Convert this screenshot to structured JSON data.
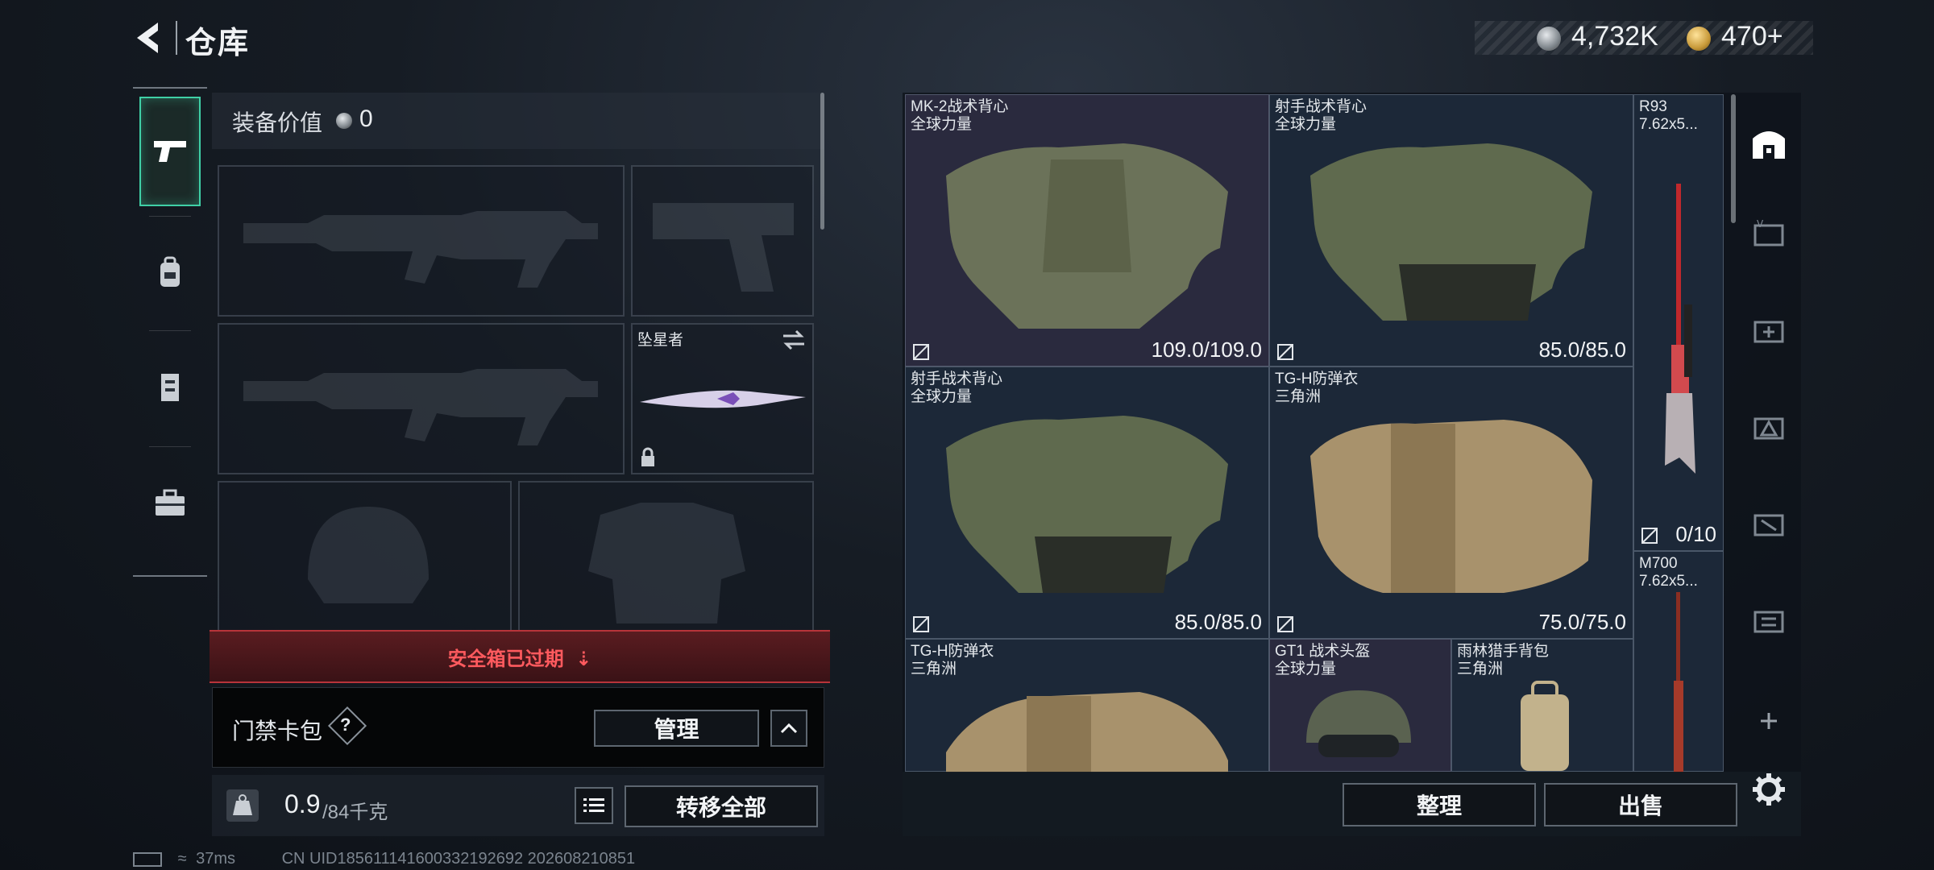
{
  "header": {
    "title": "仓库",
    "currency_silver": "4,732K",
    "currency_gold": "470+"
  },
  "left_nav": {
    "items": [
      "weapons",
      "backpack",
      "vest",
      "toolbox"
    ]
  },
  "equipment": {
    "value_label": "装备价值",
    "value": "0",
    "melee_name": "坠星者",
    "safebox_status": "安全箱已过期",
    "keycard_label": "门禁卡包",
    "keycard_help": "?",
    "manage_label": "管理",
    "weight_current": "0.9",
    "weight_capacity": "/84千克",
    "transfer_all_label": "转移全部"
  },
  "stash": {
    "items": [
      {
        "name": "MK-2战术背心",
        "sub": "全球力量",
        "durability": "109.0/109.0"
      },
      {
        "name": "射手战术背心",
        "sub": "全球力量",
        "durability": "85.0/85.0"
      },
      {
        "name": "射手战术背心",
        "sub": "全球力量",
        "durability": "85.0/85.0"
      },
      {
        "name": "TG-H防弹衣",
        "sub": "三角洲",
        "durability": "75.0/75.0"
      },
      {
        "name": "TG-H防弹衣",
        "sub": "三角洲",
        "durability": ""
      },
      {
        "name": "GT1 战术头盔",
        "sub": "全球力量",
        "durability": ""
      },
      {
        "name": "雨林猎手背包",
        "sub": "三角洲",
        "durability": ""
      }
    ],
    "side_items": [
      {
        "name": "R93",
        "sub": "7.62x5...",
        "count": "0/10"
      },
      {
        "name": "M700",
        "sub": "7.62x5..."
      }
    ],
    "sort_label": "整理",
    "sell_label": "出售"
  },
  "status_bar": {
    "ping": "37ms",
    "uid": "CN UID185611141600332192692 202608210851"
  },
  "colors": {
    "accent": "#3fd0a6",
    "warning": "#ff5a5e",
    "panel": "#1c2838"
  }
}
